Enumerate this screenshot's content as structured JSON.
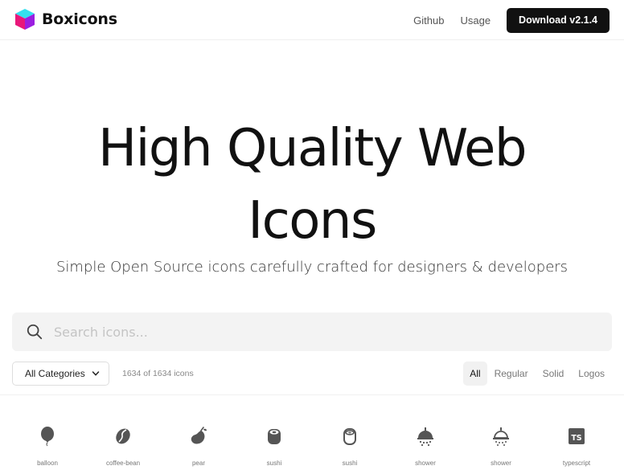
{
  "header": {
    "brand": "Boxicons",
    "nav": {
      "github": "Github",
      "usage": "Usage"
    },
    "download_label": "Download v2.1.4"
  },
  "hero": {
    "title_line1": "High Quality Web",
    "title_line2": "Icons",
    "subtitle": "Simple Open Source icons carefully crafted for designers & developers"
  },
  "search": {
    "placeholder": "Search icons..."
  },
  "toolbar": {
    "category_selected": "All Categories",
    "count_text": "1634 of 1634 icons",
    "filters": [
      "All",
      "Regular",
      "Solid",
      "Logos"
    ],
    "active_filter": "All"
  },
  "icons": [
    {
      "name": "balloon",
      "icon": "balloon-icon"
    },
    {
      "name": "coffee-bean",
      "icon": "coffee-bean-icon"
    },
    {
      "name": "pear",
      "icon": "pear-icon"
    },
    {
      "name": "sushi",
      "icon": "sushi-icon"
    },
    {
      "name": "sushi",
      "icon": "sushi-icon"
    },
    {
      "name": "shower",
      "icon": "shower-icon"
    },
    {
      "name": "shower",
      "icon": "shower-icon"
    },
    {
      "name": "typescript",
      "icon": "typescript-icon",
      "glyph": "TS"
    }
  ],
  "colors": {
    "brand_dark": "#111111",
    "logo_cyan": "#2fd6e8",
    "logo_pink": "#e8177a",
    "icon_gray": "#555555"
  }
}
